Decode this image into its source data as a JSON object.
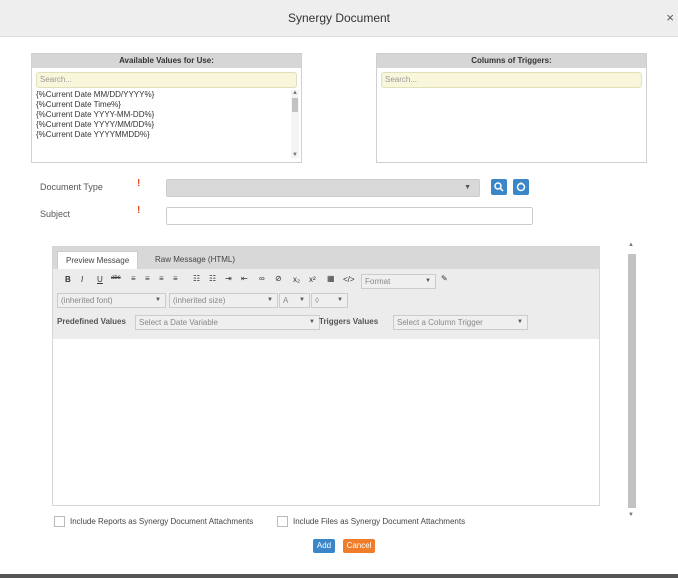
{
  "window": {
    "title": "Synergy Document",
    "close_glyph": "×"
  },
  "available_values": {
    "header": "Available Values for Use:",
    "search_placeholder": "Search...",
    "items": [
      "{%Current Date MM/DD/YYYY%}",
      "{%Current Date Time%}",
      "{%Current Date YYYY-MM-DD%}",
      "{%Current Date YYYY/MM/DD%}",
      "{%Current Date YYYYMMDD%}"
    ]
  },
  "columns_of_triggers": {
    "header": "Columns of Triggers:",
    "search_placeholder": "Search..."
  },
  "form": {
    "document_type_label": "Document Type",
    "subject_label": "Subject",
    "required_glyph": "!"
  },
  "editor": {
    "tabs": [
      "Preview Message",
      "Raw Message (HTML)"
    ],
    "toolbar": {
      "bold": "B",
      "italic": "I",
      "underline": "U",
      "strike": "abc",
      "subscript": "x₂",
      "superscript": "x²",
      "html": "</>",
      "format_label": "Format",
      "font_label": "(inherited font)",
      "size_label": "(inherited size)",
      "font_color": "A"
    },
    "predefined_values_label": "Predefined Values",
    "predefined_values_placeholder": "Select a Date Variable",
    "triggers_values_label": "Triggers Values",
    "triggers_values_placeholder": "Select a Column Trigger"
  },
  "options": {
    "include_reports": "Include Reports as Synergy Document Attachments",
    "include_files": "Include Files as Synergy Document Attachments"
  },
  "buttons": {
    "add": "Add",
    "cancel": "Cancel"
  },
  "colors": {
    "primary": "#3a86c8",
    "cancel": "#f07d2a",
    "required": "#e04b1f",
    "search_bg": "#f8f7dc"
  }
}
